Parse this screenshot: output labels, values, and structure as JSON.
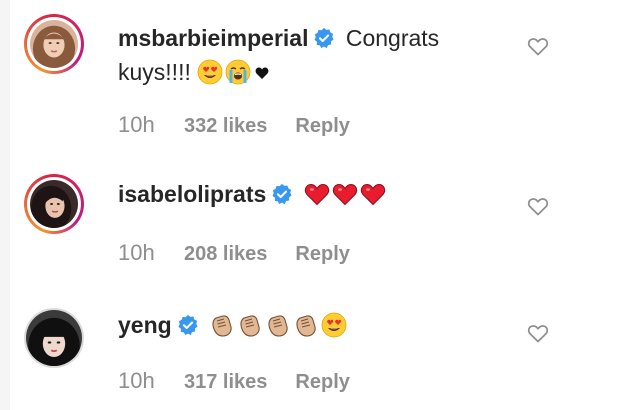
{
  "comments": [
    {
      "username": "msbarbieimperial",
      "verified": true,
      "text": "Congrats kuys!!!!",
      "emojis": [
        "heart-eyes",
        "loudly-crying",
        "black-heart"
      ],
      "time": "10h",
      "likes": "332 likes",
      "reply": "Reply"
    },
    {
      "username": "isabeloliprats",
      "verified": true,
      "text": "",
      "emojis": [
        "red-heart",
        "red-heart",
        "red-heart"
      ],
      "time": "10h",
      "likes": "208 likes",
      "reply": "Reply"
    },
    {
      "username": "yeng",
      "verified": true,
      "text": "",
      "emojis": [
        "clapping-hands",
        "clapping-hands",
        "clapping-hands",
        "clapping-hands",
        "heart-eyes"
      ],
      "time": "10h",
      "likes": "317 likes",
      "reply": "Reply"
    }
  ],
  "colors": {
    "verified_badge": "#3897f0",
    "meta_text": "#8e8e8e",
    "body_text": "#262626"
  }
}
